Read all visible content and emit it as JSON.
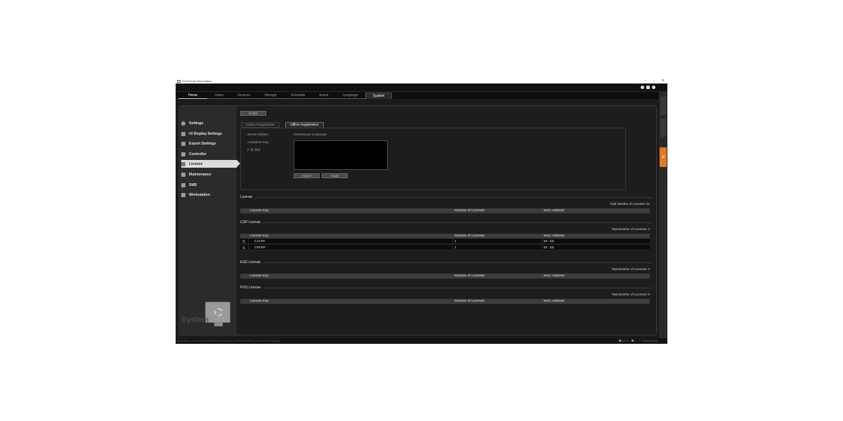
{
  "window": {
    "title": "OneSecure Workstation",
    "controls": [
      "–",
      "▫",
      "✕"
    ]
  },
  "tabs": [
    {
      "label": "Home",
      "active": false
    },
    {
      "label": "Users",
      "active": false
    },
    {
      "label": "Devices",
      "active": false
    },
    {
      "label": "Storage",
      "active": false
    },
    {
      "label": "Schedule",
      "active": false
    },
    {
      "label": "Event",
      "active": false
    },
    {
      "label": "Language",
      "active": false
    },
    {
      "label": "System",
      "active": true
    }
  ],
  "sidebar": {
    "items": [
      {
        "label": "Settings",
        "icon": "gear-icon"
      },
      {
        "label": "UI Display Settings",
        "icon": "display-icon"
      },
      {
        "label": "Export Settings",
        "icon": "export-icon"
      },
      {
        "label": "Controller",
        "icon": "controller-icon"
      },
      {
        "label": "License",
        "icon": "key-icon",
        "selected": true
      },
      {
        "label": "Maintenance",
        "icon": "folder-icon"
      },
      {
        "label": "SMS",
        "icon": "sms-icon"
      },
      {
        "label": "Workstation",
        "icon": "workstation-icon"
      }
    ],
    "footer_label": "System"
  },
  "registration": {
    "delete_label": "Delete",
    "tabs": [
      {
        "label": "Online Registration",
        "active": false
      },
      {
        "label": "Offline Registration",
        "active": true
      }
    ],
    "server_edition_label": "Server Edition",
    "server_edition_value": "OneSecure Corporate",
    "activation_key_label": "Activation Key",
    "file_hint": "(*.lic file)",
    "import_label": "Import",
    "apply_label": "Apply"
  },
  "columns": {
    "key": "License Key",
    "num": "Number of Licenses",
    "mac": "MAC Address"
  },
  "sections": {
    "license": {
      "title": "License",
      "total": "Total Number of Licenses: 64"
    },
    "cdp": {
      "title": "CDP License",
      "total": "Total Number of Licenses: 2",
      "rows": [
        {
          "key": "CACPA",
          "num": "1",
          "mac": "50 : E5"
        },
        {
          "key": "CPDPP",
          "num": "1",
          "mac": "50 : E5"
        }
      ]
    },
    "exd": {
      "title": "EXD License",
      "total": "Total Number of Licenses: 0"
    },
    "pos": {
      "title": "POS License",
      "total": "Total Number of Licenses: 0"
    }
  },
  "status": {
    "path": "Snapshot to: C:\\Users\\0202\\Desktop\\OSnow\\0d_20211102153755_5e5_UTC+0000.jpg",
    "user": "admin",
    "count": "1",
    "extra": "0 : ##########"
  }
}
